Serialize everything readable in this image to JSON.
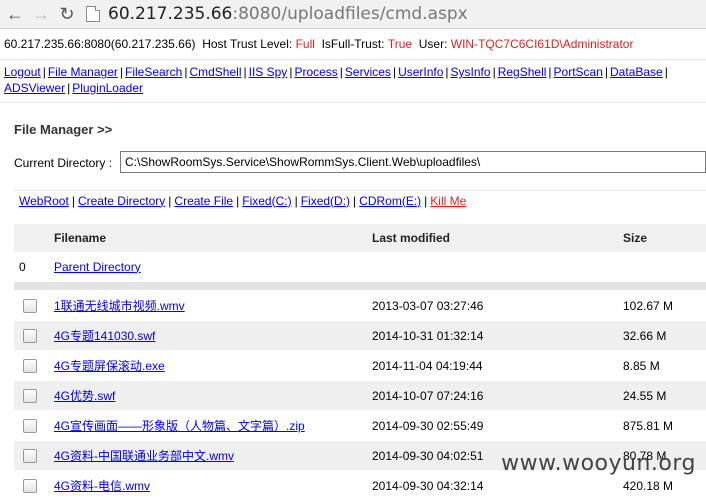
{
  "browser": {
    "url_host": "60.217.235.66",
    "url_rest": ":8080/uploadfiles/cmd.aspx"
  },
  "info": {
    "server": "60.217.235.66:8080(60.217.235.66)",
    "trust_label": "Host Trust Level:",
    "trust_value": "Full",
    "isfull_label": "IsFull-Trust:",
    "isfull_value": "True",
    "user_label": "User:",
    "user_value": "WIN-TQC7C6CI61D\\Administrator"
  },
  "menu": [
    "Logout",
    "File Manager",
    "FileSearch",
    "CmdShell",
    "IIS Spy",
    "Process",
    "Services",
    "UserInfo",
    "SysInfo",
    "RegShell",
    "PortScan",
    "DataBase",
    "ADSViewer",
    "PluginLoader"
  ],
  "section_title": "File Manager >>",
  "current_dir": {
    "label": "Current Directory :",
    "value": "C:\\ShowRoomSys.Service\\ShowRommSys.Client.Web\\uploadfiles\\"
  },
  "actions": [
    "WebRoot",
    "Create Directory",
    "Create File",
    "Fixed(C:)",
    "Fixed(D:)",
    "CDRom(E:)",
    "Kill Me"
  ],
  "table": {
    "headers": {
      "filename": "Filename",
      "modified": "Last modified",
      "size": "Size"
    },
    "parent": {
      "index": "0",
      "label": "Parent Directory"
    },
    "rows": [
      {
        "name": "1联通无线城市视频.wmv",
        "modified": "2013-03-07 03:27:46",
        "size": "102.67 M"
      },
      {
        "name": "4G专题141030.swf",
        "modified": "2014-10-31 01:32:14",
        "size": "32.66 M"
      },
      {
        "name": "4G专题屏保滚动.exe",
        "modified": "2014-11-04 04:19:44",
        "size": "8.85 M"
      },
      {
        "name": "4G优势.swf",
        "modified": "2014-10-07 07:24:16",
        "size": "24.55 M"
      },
      {
        "name": "4G宣传画面——形象版（人物篇、文字篇）.zip",
        "modified": "2014-09-30 02:55:49",
        "size": "875.81 M"
      },
      {
        "name": "4G资料-中国联通业务部中文.wmv",
        "modified": "2014-09-30 04:02:51",
        "size": "80.78 M"
      },
      {
        "name": "4G资料-电信.wmv",
        "modified": "2014-09-30 04:32:14",
        "size": "420.18 M"
      }
    ]
  },
  "watermark": "www.wooyun.org"
}
